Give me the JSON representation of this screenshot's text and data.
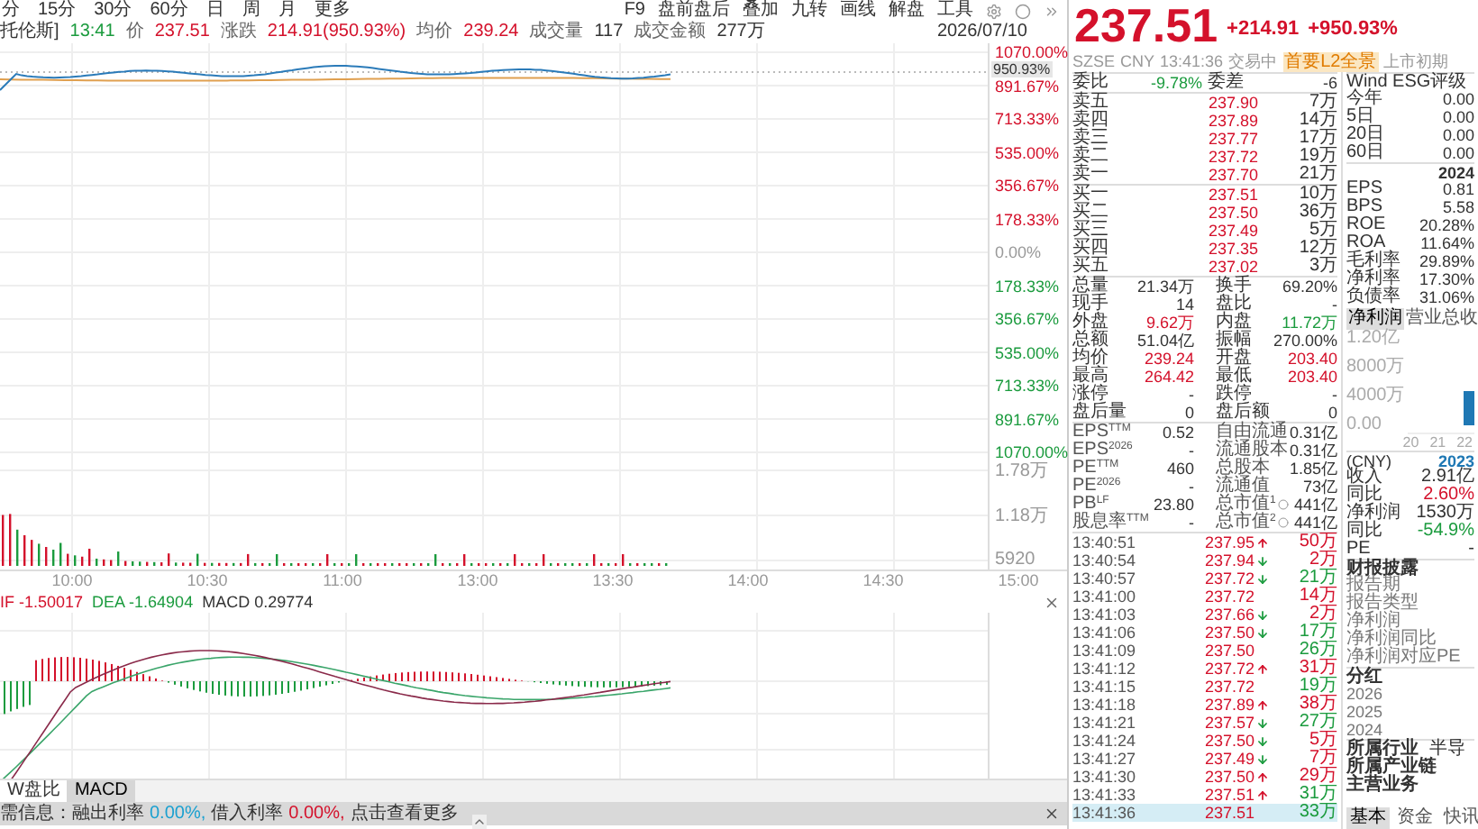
{
  "toolbar": {
    "periods": [
      "分",
      "15分",
      "30分",
      "60分",
      "日",
      "周",
      "月",
      "更多"
    ],
    "tools": [
      "F9",
      "盘前盘后",
      "叠加",
      "九转",
      "画线",
      "解盘",
      "工具"
    ]
  },
  "quote_line": {
    "name": "托伦斯]",
    "time": "13:41",
    "items": [
      {
        "label": "价",
        "value": "237.51",
        "color": "#d4112b"
      },
      {
        "label": "涨跌",
        "value": "214.91(950.93%)",
        "color": "#d4112b"
      },
      {
        "label": "均价",
        "value": "239.24",
        "color": "#d4112b"
      },
      {
        "label": "成交量",
        "value": "117",
        "color": "#333333"
      },
      {
        "label": "成交金额",
        "value": "277万",
        "color": "#333333"
      }
    ],
    "date": "2026/07/10"
  },
  "price_axis": {
    "labels": [
      {
        "text": "1070.00%",
        "color": "#d4112b"
      },
      {
        "text": "891.67%",
        "color": "#d4112b"
      },
      {
        "text": "713.33%",
        "color": "#d4112b"
      },
      {
        "text": "535.00%",
        "color": "#d4112b"
      },
      {
        "text": "356.67%",
        "color": "#d4112b"
      },
      {
        "text": "178.33%",
        "color": "#d4112b"
      },
      {
        "text": "0.00%",
        "color": "#999999"
      },
      {
        "text": "178.33%",
        "color": "#1b9b3e"
      },
      {
        "text": "356.67%",
        "color": "#1b9b3e"
      },
      {
        "text": "535.00%",
        "color": "#1b9b3e"
      },
      {
        "text": "713.33%",
        "color": "#1b9b3e"
      },
      {
        "text": "891.67%",
        "color": "#1b9b3e"
      },
      {
        "text": "1070.00%",
        "color": "#1b9b3e"
      }
    ],
    "current": "950.93%"
  },
  "volume_axis": [
    "1.78万",
    "1.18万",
    "5920"
  ],
  "time_axis": [
    "10:00",
    "10:30",
    "11:00",
    "13:00",
    "13:30",
    "14:00",
    "14:30",
    "15:00"
  ],
  "macd": {
    "labels": [
      {
        "text": "IF -1.50017",
        "color": "#d4112b"
      },
      {
        "text": "DEA -1.64904",
        "color": "#1b9b3e"
      },
      {
        "text": "MACD 0.29774",
        "color": "#333333"
      }
    ]
  },
  "indicator_tabs": [
    {
      "label": "W盘比",
      "selected": false
    },
    {
      "label": "MACD",
      "selected": true
    }
  ],
  "status_bar": [
    {
      "text": "需信息：融出利率",
      "color": "#333333"
    },
    {
      "text": "0.00%,",
      "color": "#1aa0d0"
    },
    {
      "text": "借入利率",
      "color": "#333333"
    },
    {
      "text": "0.00%,",
      "color": "#d4112b"
    },
    {
      "text": "点击查看更多",
      "color": "#333333"
    }
  ],
  "quote": {
    "price": "237.51",
    "change": "+214.91",
    "change_pct": "+950.93%",
    "color": "#d4112b"
  },
  "meta": [
    {
      "text": "SZSE",
      "kind": "plain"
    },
    {
      "text": "CNY",
      "kind": "plain"
    },
    {
      "text": "13:41:36",
      "kind": "plain"
    },
    {
      "text": "交易中",
      "kind": "plain"
    },
    {
      "text": "首要L2全景",
      "kind": "badge"
    },
    {
      "text": "上市初期",
      "kind": "plain"
    }
  ],
  "order_book": {
    "summary": [
      {
        "label": "委比",
        "value": "-9.78%",
        "color": "#1b9b3e"
      },
      {
        "label": "委差",
        "value": "-6",
        "color": "#333333"
      }
    ],
    "asks": [
      {
        "label": "卖五",
        "price": "237.90",
        "volume": "7万"
      },
      {
        "label": "卖四",
        "price": "237.89",
        "volume": "14万"
      },
      {
        "label": "卖三",
        "price": "237.77",
        "volume": "17万"
      },
      {
        "label": "卖二",
        "price": "237.72",
        "volume": "19万"
      },
      {
        "label": "卖一",
        "price": "237.70",
        "volume": "21万"
      }
    ],
    "bids": [
      {
        "label": "买一",
        "price": "237.51",
        "volume": "10万"
      },
      {
        "label": "买二",
        "price": "237.50",
        "volume": "36万"
      },
      {
        "label": "买三",
        "price": "237.49",
        "volume": "5万"
      },
      {
        "label": "买四",
        "price": "237.35",
        "volume": "12万"
      },
      {
        "label": "买五",
        "price": "237.02",
        "volume": "3万"
      }
    ]
  },
  "stats": [
    {
      "label": "总量",
      "value": "21.34万",
      "color": "#333333"
    },
    {
      "label": "换手",
      "value": "69.20%",
      "color": "#333333"
    },
    {
      "label": "现手",
      "value": "14",
      "color": "#333333"
    },
    {
      "label": "盘比",
      "value": "-"
    },
    {
      "label": "外盘",
      "value": "9.62万",
      "color": "#d4112b"
    },
    {
      "label": "内盘",
      "value": "11.72万",
      "color": "#1b9b3e"
    },
    {
      "label": "总额",
      "value": "51.04亿",
      "color": "#333333"
    },
    {
      "label": "振幅",
      "value": "270.00%",
      "color": "#333333"
    },
    {
      "label": "均价",
      "value": "239.24",
      "color": "#d4112b"
    },
    {
      "label": "开盘",
      "value": "203.40",
      "color": "#d4112b"
    },
    {
      "label": "最高",
      "value": "264.42",
      "color": "#d4112b"
    },
    {
      "label": "最低",
      "value": "203.40",
      "color": "#d4112b"
    },
    {
      "label": "涨停",
      "value": "-"
    },
    {
      "label": "跌停",
      "value": "-"
    },
    {
      "label": "盘后量",
      "value": "0",
      "color": "#333333"
    },
    {
      "label": "盘后额",
      "value": "0",
      "color": "#333333"
    }
  ],
  "valuation": [
    {
      "label": "EPS$^{TTM}$",
      "value": "0.52"
    },
    {
      "label": "自由流通",
      "value": "0.31亿"
    },
    {
      "label": "EPS$^{2026}$",
      "value": "-"
    },
    {
      "label": "流通股本",
      "value": "0.31亿"
    },
    {
      "label": "PE$^{TTM}$",
      "value": "460"
    },
    {
      "label": "总股本",
      "value": "1.85亿"
    },
    {
      "label": "PE$^{2026}$",
      "value": "-"
    },
    {
      "label": "流通值",
      "value": "73亿"
    },
    {
      "label": "PB$^{LF}$",
      "value": "23.80"
    },
    {
      "label": "总市值$^{1}$",
      "value": "441亿",
      "info": true
    },
    {
      "label": "股息率$^{TTM}$",
      "value": "-"
    },
    {
      "label": "总市值$^{2}$",
      "value": "441亿",
      "info": true
    }
  ],
  "trades": [
    {
      "time": "13:40:51",
      "price": "237.95",
      "kind": "up",
      "volume": "50万",
      "color": "#d4112b",
      "selected": false
    },
    {
      "time": "13:40:54",
      "price": "237.94",
      "kind": "down",
      "volume": "2万",
      "color": "#d4112b",
      "selected": false
    },
    {
      "time": "13:40:57",
      "price": "237.72",
      "kind": "down",
      "volume": "21万",
      "color": "#1b9b3e",
      "selected": false
    },
    {
      "time": "13:41:00",
      "price": "237.72",
      "kind": "plain",
      "volume": "14万",
      "color": "#d4112b",
      "selected": false
    },
    {
      "time": "13:41:03",
      "price": "237.66",
      "kind": "down",
      "volume": "2万",
      "color": "#d4112b",
      "selected": false
    },
    {
      "time": "13:41:06",
      "price": "237.50",
      "kind": "down",
      "volume": "17万",
      "color": "#1b9b3e",
      "selected": false
    },
    {
      "time": "13:41:09",
      "price": "237.50",
      "kind": "plain",
      "volume": "26万",
      "color": "#1b9b3e",
      "selected": false
    },
    {
      "time": "13:41:12",
      "price": "237.72",
      "kind": "up",
      "volume": "31万",
      "color": "#d4112b",
      "selected": false
    },
    {
      "time": "13:41:15",
      "price": "237.72",
      "kind": "plain",
      "volume": "19万",
      "color": "#1b9b3e",
      "selected": false
    },
    {
      "time": "13:41:18",
      "price": "237.89",
      "kind": "up",
      "volume": "38万",
      "color": "#d4112b",
      "selected": false
    },
    {
      "time": "13:41:21",
      "price": "237.57",
      "kind": "down",
      "volume": "27万",
      "color": "#1b9b3e",
      "selected": false
    },
    {
      "time": "13:41:24",
      "price": "237.50",
      "kind": "down",
      "volume": "5万",
      "color": "#d4112b",
      "selected": false
    },
    {
      "time": "13:41:27",
      "price": "237.49",
      "kind": "down",
      "volume": "7万",
      "color": "#d4112b",
      "selected": false
    },
    {
      "time": "13:41:30",
      "price": "237.50",
      "kind": "up",
      "volume": "29万",
      "color": "#d4112b",
      "selected": false
    },
    {
      "time": "13:41:33",
      "price": "237.51",
      "kind": "up",
      "volume": "31万",
      "color": "#1b9b3e",
      "selected": false
    },
    {
      "time": "13:41:36",
      "price": "237.51",
      "kind": "plain",
      "volume": "33万",
      "color": "#1b9b3e",
      "selected": true
    }
  ],
  "esg": {
    "title": "Wind ESG评级",
    "rows": [
      {
        "label": "今年",
        "value": "0.00"
      },
      {
        "label": "5日",
        "value": "0.00"
      },
      {
        "label": "20日",
        "value": "0.00"
      },
      {
        "label": "60日",
        "value": "0.00"
      }
    ]
  },
  "finance": {
    "year": "2024",
    "rows": [
      {
        "label": "EPS",
        "value": "0.81"
      },
      {
        "label": "BPS",
        "value": "5.58"
      },
      {
        "label": "ROE",
        "value": "20.28%"
      },
      {
        "label": "ROA",
        "value": "11.64%"
      },
      {
        "label": "毛利率",
        "value": "29.89%"
      },
      {
        "label": "净利率",
        "value": "17.30%"
      },
      {
        "label": "负债率",
        "value": "31.06%"
      }
    ]
  },
  "finance_tabs": [
    {
      "label": "净利润",
      "selected": true
    },
    {
      "label": "营业总收",
      "selected": false
    }
  ],
  "mini_chart": {
    "yticks": [
      "1.20亿",
      "8000万",
      "4000万",
      "0.00"
    ],
    "xticks": [
      "20",
      "21",
      "22"
    ]
  },
  "summary": {
    "label": "(CNY)",
    "year": "2023",
    "rows": [
      {
        "label": "收入",
        "value": "2.91亿",
        "color": "#333333"
      },
      {
        "label": "同比",
        "value": "2.60%",
        "color": "#d4112b"
      },
      {
        "label": "净利润",
        "value": "1530万",
        "color": "#333333"
      },
      {
        "label": "同比",
        "value": "-54.9%",
        "color": "#1b9b3e"
      },
      {
        "label": "PE",
        "value": "-",
        "color": "#333333"
      }
    ]
  },
  "report": {
    "title": "财报披露",
    "rows": [
      "报告期",
      "报告类型",
      "净利润",
      "净利润同比",
      "净利润对应PE"
    ]
  },
  "dividend": {
    "title": "分红",
    "rows": [
      "2026",
      "2025",
      "2024"
    ]
  },
  "profile": [
    {
      "label": "所属行业",
      "value": "半导"
    },
    {
      "label": "所属产业链"
    },
    {
      "label": "主营业务"
    }
  ],
  "bottom_tabs": [
    {
      "label": "基本",
      "selected": true
    },
    {
      "label": "资金",
      "selected": false
    },
    {
      "label": "快讯",
      "selected": false
    }
  ]
}
